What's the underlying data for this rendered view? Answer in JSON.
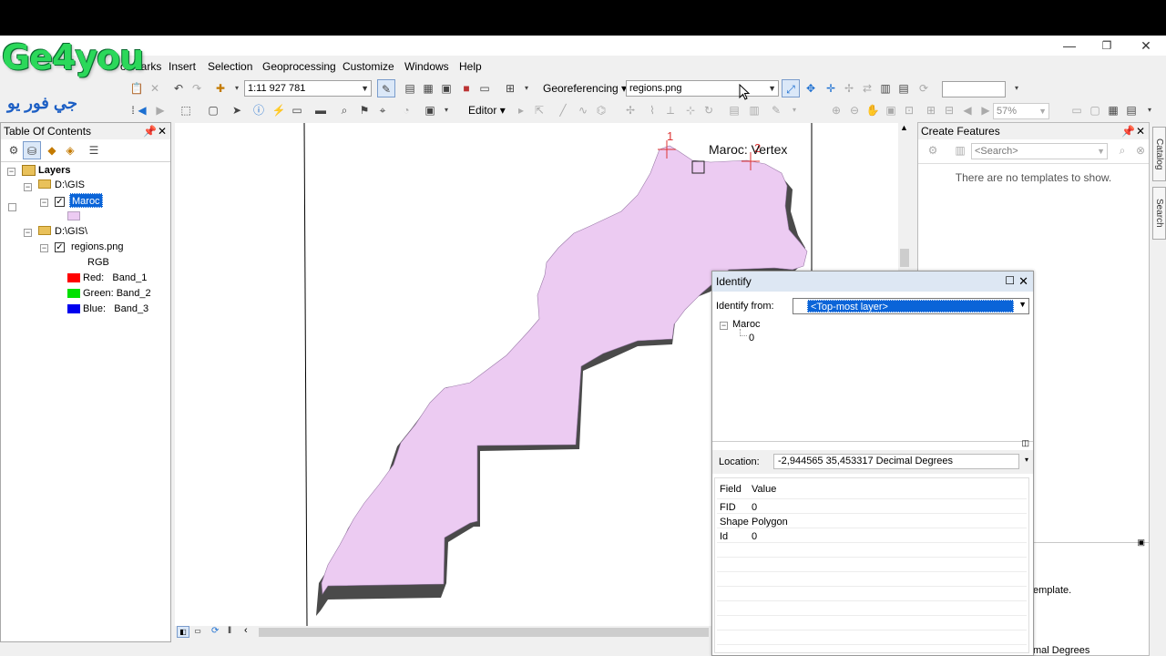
{
  "logo": {
    "text": "Ge4you",
    "arabic": "جي فور يو"
  },
  "window_controls": {
    "minimize": "—",
    "restore": "❐",
    "close": "✕"
  },
  "menu": [
    "okmarks",
    "Insert",
    "Selection",
    "Geoprocessing",
    "Customize",
    "Windows",
    "Help"
  ],
  "toolbar": {
    "scale": "1:11 927 781",
    "georeferencing_label": "Georeferencing",
    "georef_layer": "regions.png",
    "editor_label": "Editor",
    "zoom_percent": "57%"
  },
  "toc": {
    "title": "Table Of Contents",
    "layers_label": "Layers",
    "groups": [
      {
        "path": "D:\\GIS",
        "layer": "Maroc",
        "selected": true
      },
      {
        "path": "D:\\GIS\\",
        "layer": "regions.png",
        "sub": "RGB",
        "bands": [
          {
            "label": "Red:",
            "band": "Band_1",
            "color": "#ff0000"
          },
          {
            "label": "Green:",
            "band": "Band_2",
            "color": "#00e000"
          },
          {
            "label": "Blue:",
            "band": "Band_3",
            "color": "#0000ee"
          }
        ]
      }
    ],
    "maroc_fill": "#eccbf2"
  },
  "map": {
    "vertex_label": "Maroc: Vertex",
    "marker1": "1",
    "marker2": "2",
    "polygon_color": "#eccbf2",
    "shadow_color": "#4a4a4a"
  },
  "create_features": {
    "title": "Create Features",
    "search_placeholder": "<Search>",
    "empty_text": "There are no templates to show.",
    "partial_text_1": "emplate.",
    "partial_text_2": "mal Degrees"
  },
  "side_tabs": [
    "Catalog",
    "Search"
  ],
  "identify": {
    "title": "Identify",
    "from_label": "Identify from:",
    "from_value": "<Top-most layer>",
    "tree_layer": "Maroc",
    "tree_value": "0",
    "location_label": "Location:",
    "location_value": "-2,944565  35,453317 Decimal Degrees",
    "headers": [
      "Field",
      "Value"
    ],
    "rows": [
      {
        "field": "FID",
        "value": "0"
      },
      {
        "field": "Shape",
        "value": "Polygon"
      },
      {
        "field": "Id",
        "value": "0"
      }
    ]
  }
}
